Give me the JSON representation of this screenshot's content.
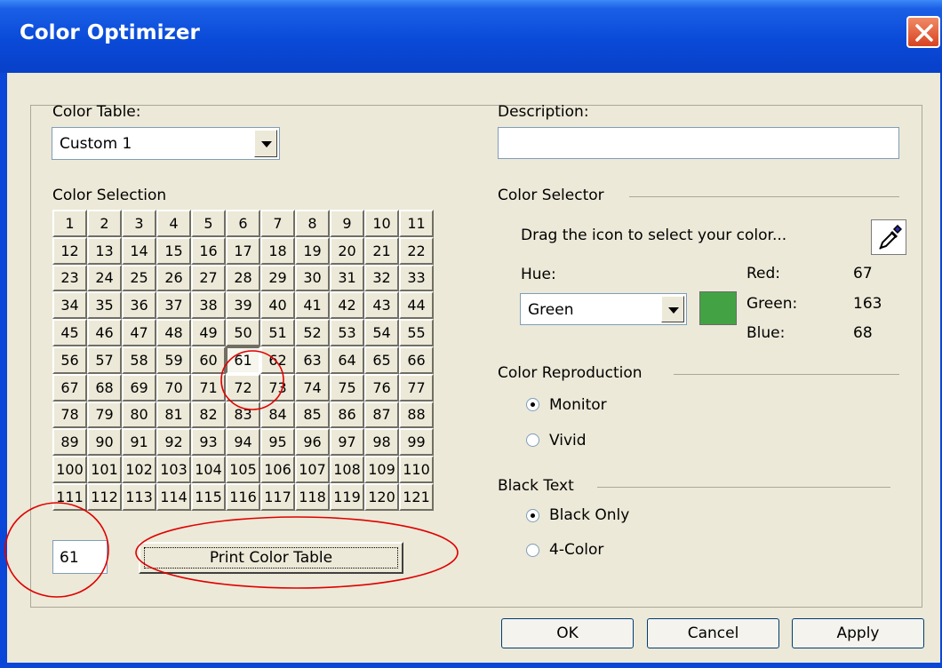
{
  "window": {
    "title": "Color Optimizer"
  },
  "color_table": {
    "label": "Color Table:",
    "value": "Custom 1"
  },
  "description": {
    "label": "Description:",
    "value": ""
  },
  "color_selection": {
    "label": "Color Selection",
    "cells": [
      "1",
      "2",
      "3",
      "4",
      "5",
      "6",
      "7",
      "8",
      "9",
      "10",
      "11",
      "12",
      "13",
      "14",
      "15",
      "16",
      "17",
      "18",
      "19",
      "20",
      "21",
      "22",
      "23",
      "24",
      "25",
      "26",
      "27",
      "28",
      "29",
      "30",
      "31",
      "32",
      "33",
      "34",
      "35",
      "36",
      "37",
      "38",
      "39",
      "40",
      "41",
      "42",
      "43",
      "44",
      "45",
      "46",
      "47",
      "48",
      "49",
      "50",
      "51",
      "52",
      "53",
      "54",
      "55",
      "56",
      "57",
      "58",
      "59",
      "60",
      "61",
      "62",
      "63",
      "64",
      "65",
      "66",
      "67",
      "68",
      "69",
      "70",
      "71",
      "72",
      "73",
      "74",
      "75",
      "76",
      "77",
      "78",
      "79",
      "80",
      "81",
      "82",
      "83",
      "84",
      "85",
      "86",
      "87",
      "88",
      "89",
      "90",
      "91",
      "92",
      "93",
      "94",
      "95",
      "96",
      "97",
      "98",
      "99",
      "100",
      "101",
      "102",
      "103",
      "104",
      "105",
      "106",
      "107",
      "108",
      "109",
      "110",
      "111",
      "112",
      "113",
      "114",
      "115",
      "116",
      "117",
      "118",
      "119",
      "120",
      "121"
    ],
    "selected": "61",
    "selected_field": "61",
    "print_button": "Print Color Table"
  },
  "color_selector": {
    "label": "Color Selector",
    "instruction": "Drag the icon to select your color...",
    "dropper_icon": "eyedropper-icon",
    "hue_label": "Hue:",
    "hue_value": "Green",
    "swatch_color": "#43a344",
    "red_label": "Red:",
    "red_value": "67",
    "green_label": "Green:",
    "green_value": "163",
    "blue_label": "Blue:",
    "blue_value": "68"
  },
  "color_reproduction": {
    "label": "Color Reproduction",
    "options": [
      "Monitor",
      "Vivid"
    ],
    "selected": "Monitor"
  },
  "black_text": {
    "label": "Black Text",
    "options": [
      "Black Only",
      "4-Color"
    ],
    "selected": "Black Only"
  },
  "buttons": {
    "ok": "OK",
    "cancel": "Cancel",
    "apply": "Apply"
  },
  "annotation_color": "#e00000"
}
